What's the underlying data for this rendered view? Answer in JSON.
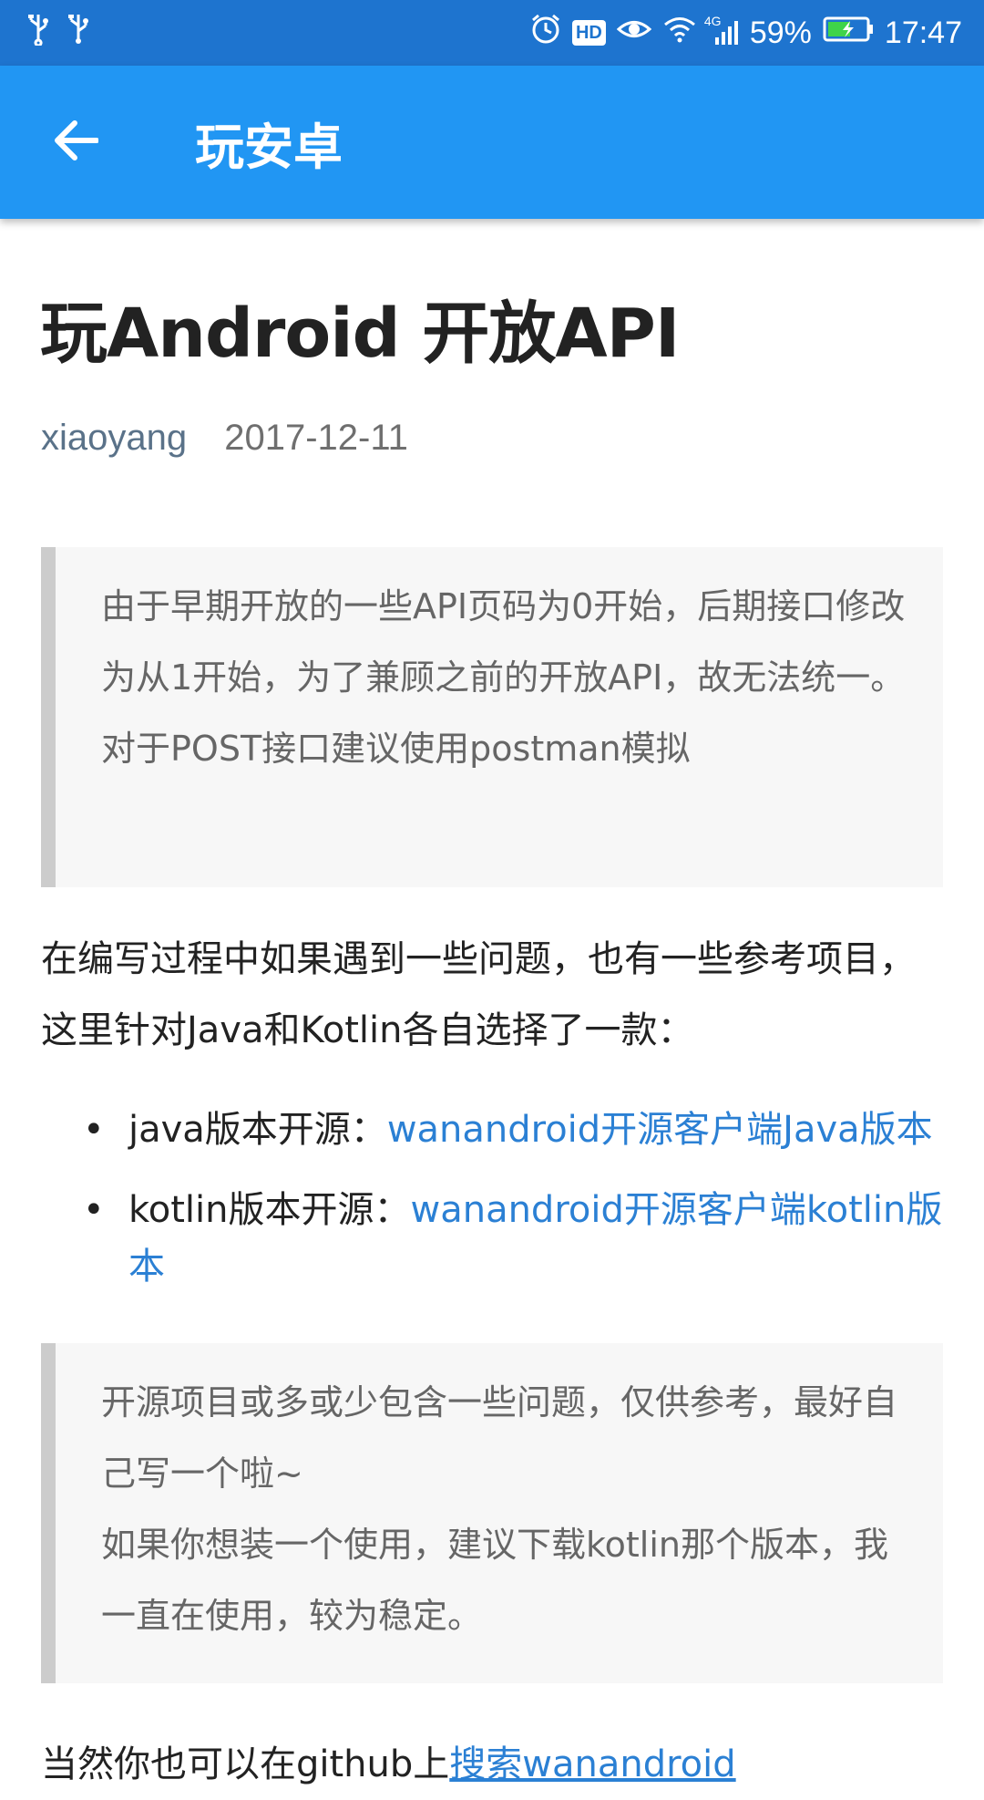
{
  "status_bar": {
    "battery": "59%",
    "time": "17:47",
    "network": "4G",
    "hd_label": "HD",
    "icons": [
      "usb-icon",
      "usb-icon",
      "alarm-icon",
      "hd-icon",
      "eye-icon",
      "wifi-icon",
      "signal-icon",
      "battery-charging-icon"
    ]
  },
  "app_bar": {
    "back_icon": "arrow-left-icon",
    "title": "玩安卓"
  },
  "article": {
    "title": "玩Android 开放API",
    "author": "xiaoyang",
    "date": "2017-12-11",
    "quote1": {
      "line1": "由于早期开放的一些API页码为0开始，后期接口修改为从1开始，为了兼顾之前的开放API，故无法统一。",
      "line2": "对于POST接口建议使用postman模拟"
    },
    "paragraph1": "在编写过程中如果遇到一些问题，也有一些参考项目，这里针对Java和Kotlin各自选择了一款：",
    "list": [
      {
        "label": "java版本开源：",
        "link": "wanandroid开源客户端Java版本"
      },
      {
        "label": "kotlin版本开源：",
        "link": "wanandroid开源客户端kotlin版本"
      }
    ],
    "quote2": {
      "line1": "开源项目或多或少包含一些问题，仅供参考，最好自己写一个啦~",
      "line2": "如果你想装一个使用，建议下载kotlin那个版本，我一直在使用，较为稳定。"
    },
    "paragraph2": {
      "text": "当然你也可以在github上",
      "link": "搜索wanandroid"
    }
  },
  "colors": {
    "status_bar": "#1e74cf",
    "app_bar": "#2196f3",
    "link": "#2b80d4",
    "quote_border": "#cccccc",
    "quote_bg": "#f7f7f7"
  }
}
